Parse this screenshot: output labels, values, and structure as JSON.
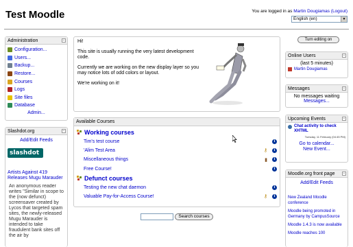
{
  "header": {
    "site_title": "Test Moodle",
    "login_prefix": "You are logged in as",
    "user_name": "Martin Dougiamas",
    "logout_label": "(Logout)",
    "language": "English (en)"
  },
  "turn_editing_label": "Turn editing on",
  "admin_block": {
    "title": "Administration",
    "items": [
      {
        "label": "Configuration...",
        "icon": "configuration-icon",
        "color": "#6b8e23"
      },
      {
        "label": "Users...",
        "icon": "users-icon",
        "color": "#4169e1"
      },
      {
        "label": "Backup...",
        "icon": "backup-icon",
        "color": "#708090"
      },
      {
        "label": "Restore...",
        "icon": "restore-icon",
        "color": "#8b4513"
      },
      {
        "label": "Courses",
        "icon": "courses-icon",
        "color": "#daa520"
      },
      {
        "label": "Logs",
        "icon": "logs-icon",
        "color": "#b22222"
      },
      {
        "label": "Site files",
        "icon": "folder-icon",
        "color": "#e6c200"
      },
      {
        "label": "Database",
        "icon": "database-icon",
        "color": "#2e8b57"
      }
    ],
    "more_label": "Admin..."
  },
  "slashdot_block": {
    "title": "Slashdot.org",
    "add_edit_label": "Add/Edit Feeds",
    "logo_text": "slashdot",
    "article_title": "Artists Against 419 Releases Mugu Marauder",
    "article_text": "An anonymous reader writes \"Similar in scope to the (now defunct) screensaver created by Lycos that targeted spam sites, the newly-released Mugu Marauder is intended to take fraudulent bank sites off the air by"
  },
  "intro": {
    "lines": [
      "Hi!",
      "This site is usually running the very latest development code.",
      "Currently we are working on the new display layer so you may notice lots of odd colors or layout.",
      "We're working on it!"
    ]
  },
  "available_courses": {
    "title": "Available Courses",
    "categories": [
      {
        "name": "Working courses",
        "courses": [
          {
            "name": "Tim's test course",
            "key": false,
            "guest": false
          },
          {
            "name": "'Alim Test Area",
            "key": true,
            "guest": false
          },
          {
            "name": "Miscellaneous things",
            "key": false,
            "guest": true
          },
          {
            "name": "Free Course!",
            "key": false,
            "guest": false
          }
        ]
      },
      {
        "name": "Defunct courses",
        "courses": [
          {
            "name": "Testing the new chat daemon",
            "key": false,
            "guest": false
          },
          {
            "name": "Valuable Pay-for-Access Course!",
            "key": true,
            "guest": false
          }
        ]
      }
    ]
  },
  "search": {
    "button_label": "Search courses",
    "value": ""
  },
  "online_users": {
    "title": "Online Users",
    "subtitle": "(last 5 minutes)",
    "users": [
      "Martin Dougiamas"
    ]
  },
  "messages": {
    "title": "Messages",
    "status": "No messages waiting",
    "link": "Messages..."
  },
  "events": {
    "title": "Upcoming Events",
    "event_title": "Chat activity to check XHTML",
    "event_time": "Tuesday, 11 February (04:45 PM)",
    "calendar_link": "Go to calendar...",
    "new_event_link": "New Event..."
  },
  "moodle_front": {
    "title": "Moodle.org front page",
    "add_edit_label": "Add/Edit Feeds",
    "items": [
      "New Zealand Moodle conference",
      "Moodle being promoted in Germany by CampusSource",
      "Moodle 1.4.3 is now available",
      "Moodle reaches 100"
    ]
  }
}
